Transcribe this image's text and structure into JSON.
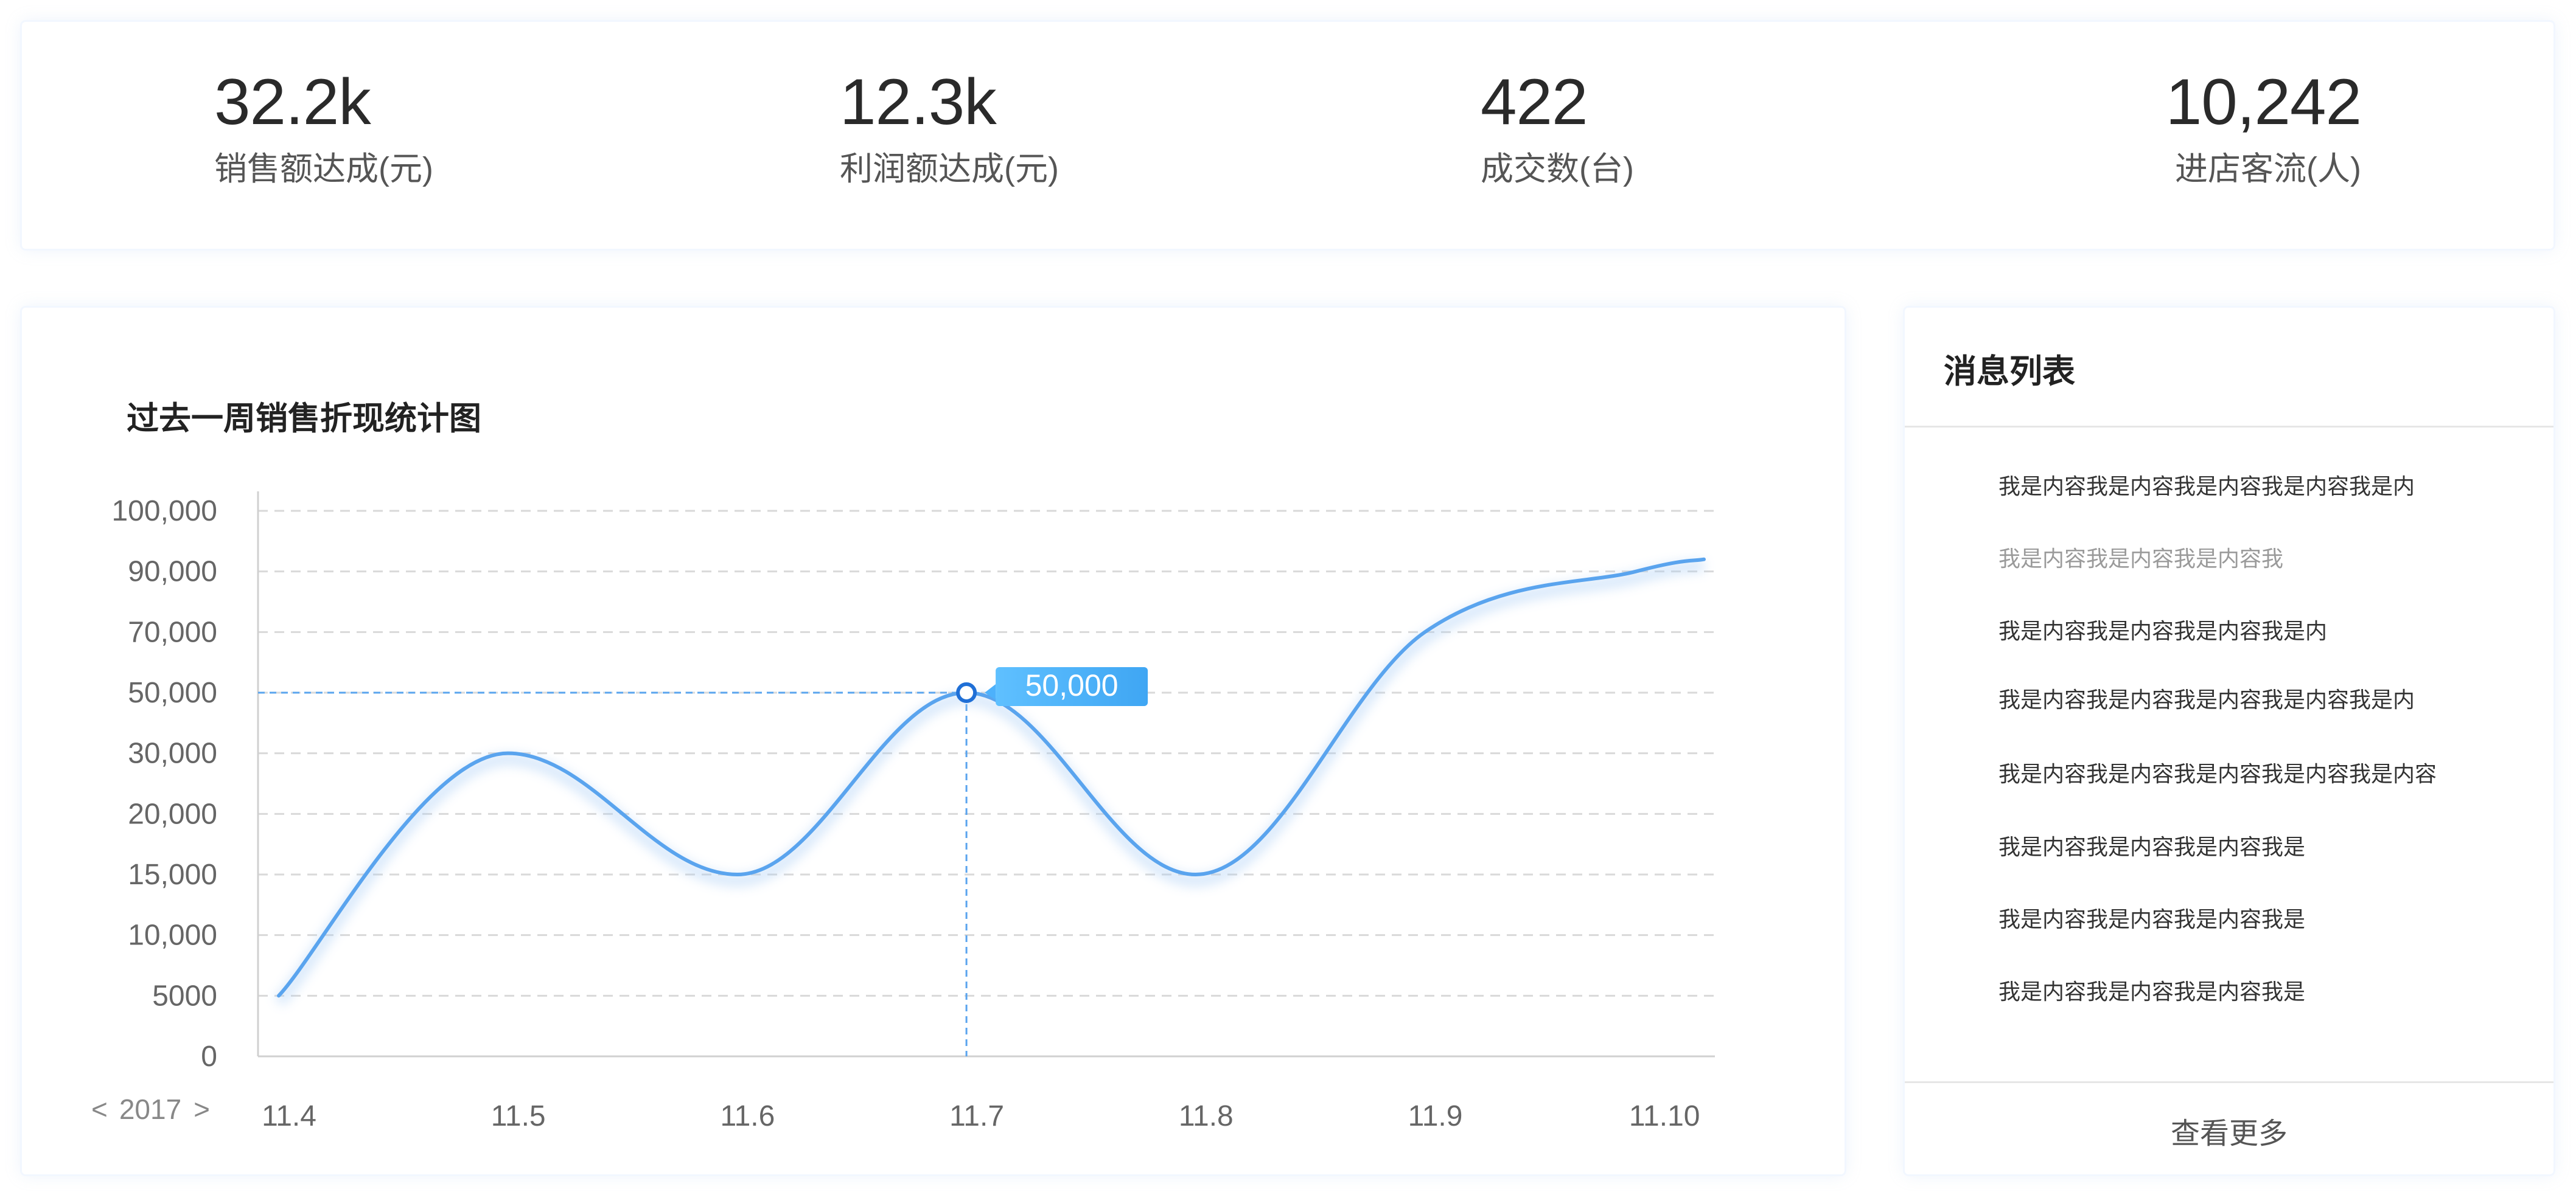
{
  "kpis": [
    {
      "value": "32.2k",
      "label": "销售额达成(元)"
    },
    {
      "value": "12.3k",
      "label": "利润额达成(元)"
    },
    {
      "value": "422",
      "label": "成交数(台)"
    },
    {
      "value": "10,242",
      "label": "进店客流(人)"
    }
  ],
  "chart": {
    "title": "过去一周销售折现统计图",
    "year_selector": {
      "prev": "<",
      "year": "2017",
      "next": ">"
    },
    "tooltip": {
      "label": "50,000",
      "index": 3
    }
  },
  "chart_data": {
    "type": "line",
    "title": "过去一周销售折现统计图",
    "categories": [
      "11.4",
      "11.5",
      "11.6",
      "11.7",
      "11.8",
      "11.9",
      "11.10"
    ],
    "y_ticks": [
      "0",
      "5000",
      "10,000",
      "15,000",
      "20,000",
      "30,000",
      "50,000",
      "70,000",
      "90,000",
      "100,000"
    ],
    "y_tick_values": [
      0,
      5000,
      10000,
      15000,
      20000,
      30000,
      50000,
      70000,
      90000,
      100000
    ],
    "y_scale": "non-uniform (ticks evenly spaced)",
    "grid": true,
    "series": [
      {
        "values": [
          5000,
          30000,
          15000,
          50000,
          15000,
          70000,
          90000
        ],
        "end_value": 92000,
        "color": "#5aa4ee"
      }
    ],
    "highlight": {
      "category": "11.7",
      "value": 50000,
      "label": "50,000"
    }
  },
  "messages": {
    "title": "消息列表",
    "items": [
      {
        "text": "我是内容我是内容我是内容我是内容我是内",
        "read": false
      },
      {
        "text": "我是内容我是内容我是内容我",
        "read": true
      },
      {
        "text": "我是内容我是内容我是内容我是内",
        "read": false
      },
      {
        "text": "我是内容我是内容我是内容我是内容我是内",
        "read": false
      },
      {
        "text": "我是内容我是内容我是内容我是内容我是内容",
        "read": false
      },
      {
        "text": "我是内容我是内容我是内容我是",
        "read": false
      },
      {
        "text": "我是内容我是内容我是内容我是",
        "read": false
      },
      {
        "text": "我是内容我是内容我是内容我是",
        "read": false
      }
    ],
    "more_label": "查看更多"
  },
  "colors": {
    "line": "#5aa4ee",
    "tooltip_bg": "#4db1fb",
    "grid": "#d9d9d9",
    "guide": "#5aa4ee"
  }
}
